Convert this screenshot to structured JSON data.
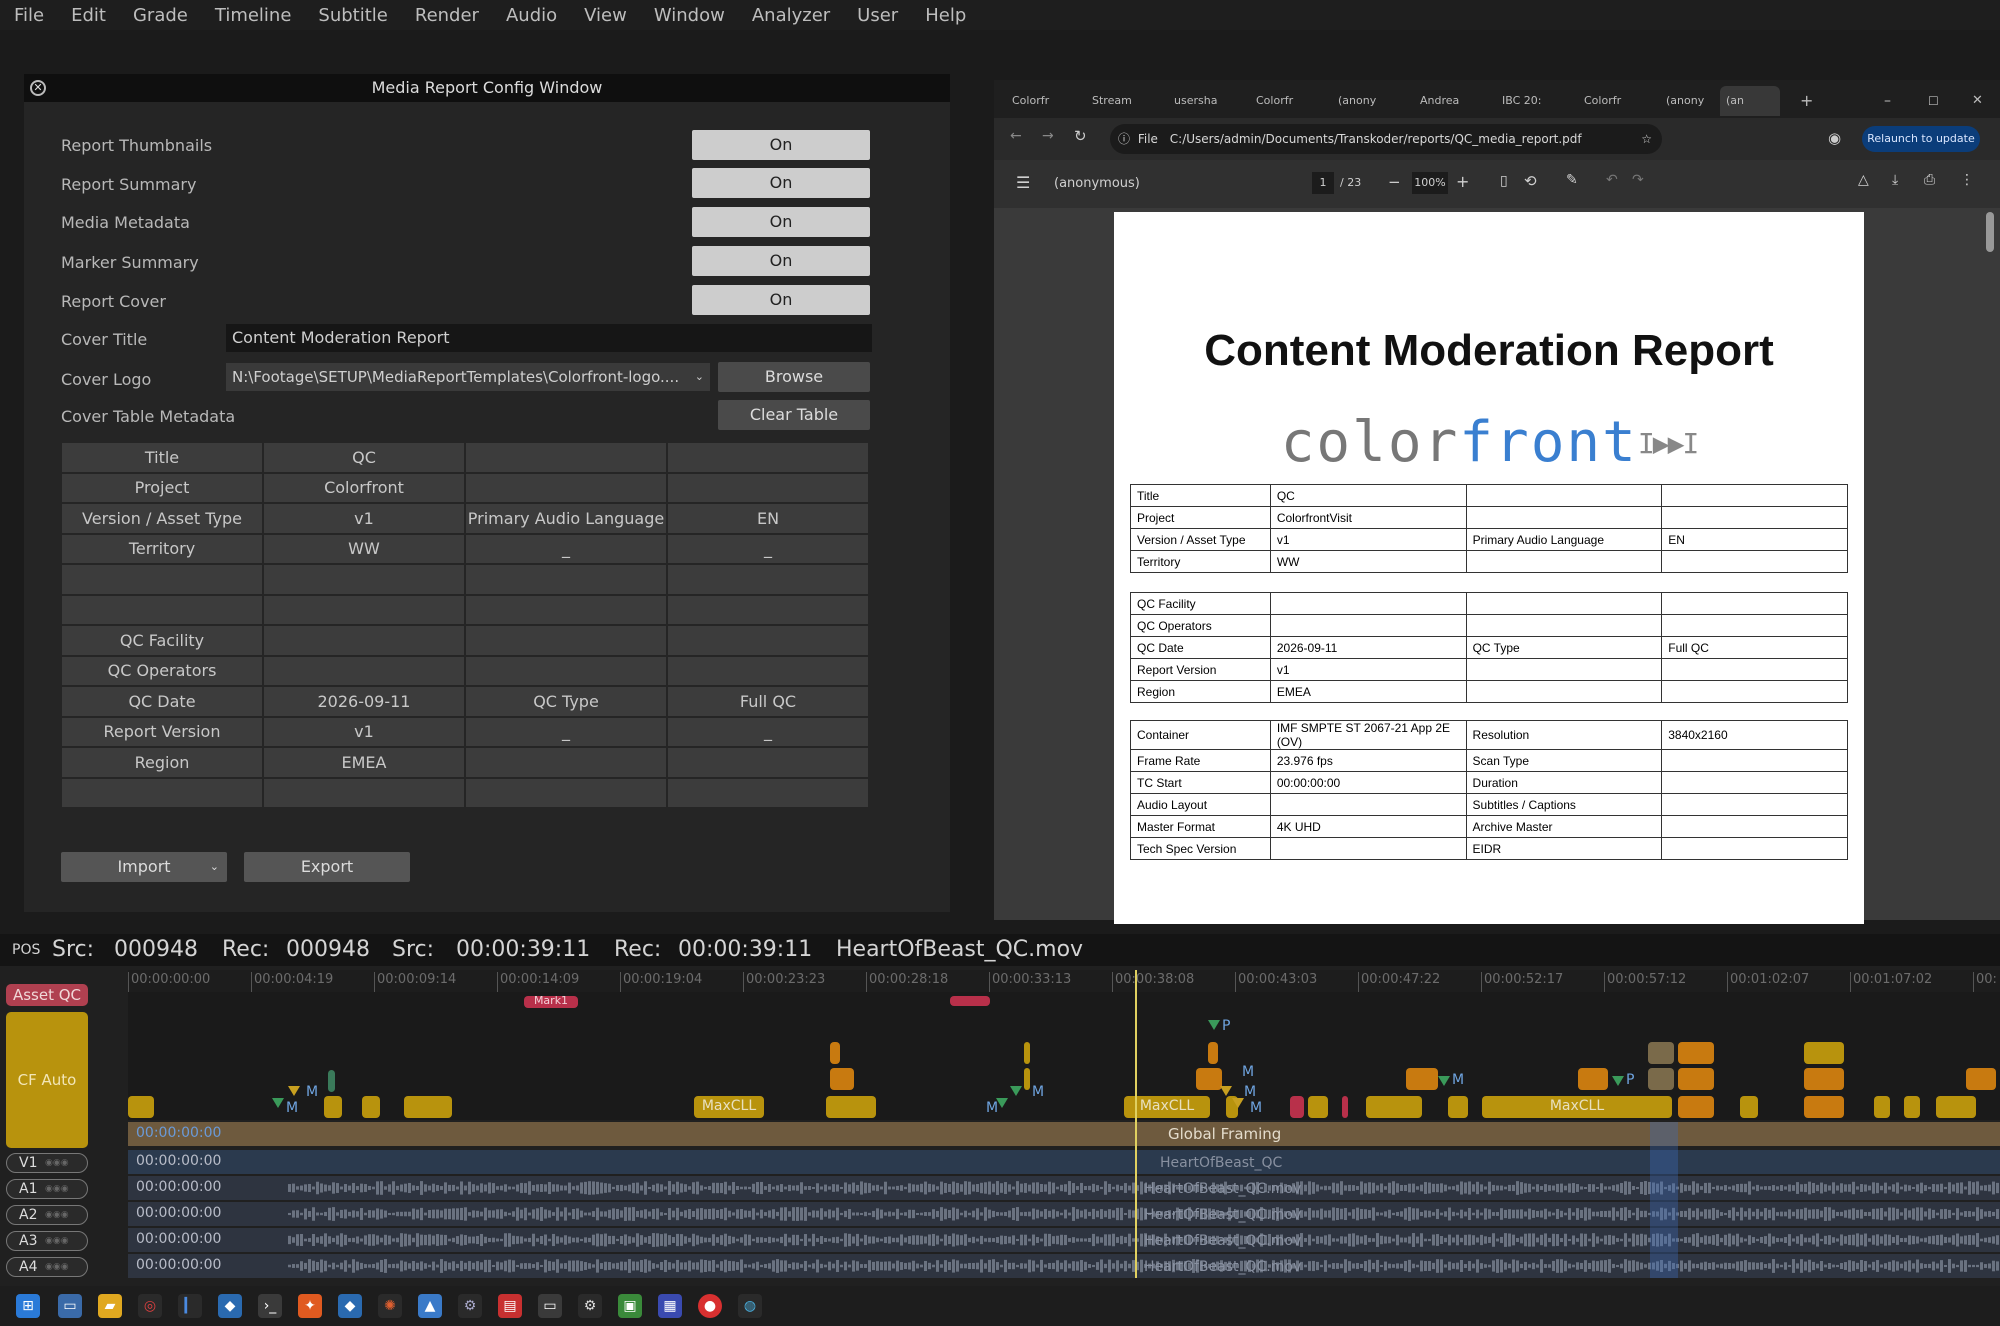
{
  "menu": [
    "File",
    "Edit",
    "Grade",
    "Timeline",
    "Subtitle",
    "Render",
    "Audio",
    "View",
    "Window",
    "Analyzer",
    "User",
    "Help"
  ],
  "config_window": {
    "title": "Media Report Config Window",
    "close_glyph": "✕",
    "toggles": [
      {
        "label": "Report Thumbnails",
        "value": "On"
      },
      {
        "label": "Report Summary",
        "value": "On"
      },
      {
        "label": "Media Metadata",
        "value": "On"
      },
      {
        "label": "Marker Summary",
        "value": "On"
      },
      {
        "label": "Report Cover",
        "value": "On"
      }
    ],
    "cover_title_label": "Cover Title",
    "cover_title_value": "Content Moderation Report",
    "cover_logo_label": "Cover Logo",
    "cover_logo_value": "N:\\Footage\\SETUP\\MediaReportTemplates\\Colorfront-logo....",
    "browse_label": "Browse",
    "cover_table_label": "Cover Table Metadata",
    "clear_table_label": "Clear Table",
    "table_rows": [
      [
        "Title",
        "QC",
        "",
        ""
      ],
      [
        "Project",
        "Colorfront",
        "",
        ""
      ],
      [
        "Version / Asset Type",
        "v1",
        "Primary Audio Language",
        "EN"
      ],
      [
        "Territory",
        "WW",
        "_",
        "_"
      ],
      [
        "",
        "",
        "",
        ""
      ],
      [
        "",
        "",
        "",
        ""
      ],
      [
        "QC Facility",
        "",
        "",
        ""
      ],
      [
        "QC Operators",
        "",
        "",
        ""
      ],
      [
        "QC Date",
        "2026-09-11",
        "QC Type",
        "Full QC"
      ],
      [
        "Report Version",
        "v1",
        "_",
        "_"
      ],
      [
        "Region",
        "EMEA",
        "",
        ""
      ],
      [
        "",
        "",
        "",
        ""
      ]
    ],
    "import_label": "Import",
    "export_label": "Export"
  },
  "browser": {
    "tabs": [
      "Colorfr",
      "Stream",
      "usersha",
      "Colorfr",
      "(anony",
      "Andrea",
      "IBC 20:",
      "Colorfr",
      "(anony",
      "(an"
    ],
    "new_tab": "+",
    "url_prefix": "File",
    "url": "C:/Users/admin/Documents/Transkoder/reports/QC_media_report.pdf",
    "relaunch": "Relaunch to update",
    "pdf_name": "(anonymous)",
    "page_current": "1",
    "page_total": "/ 23",
    "zoom": "100%"
  },
  "pdf": {
    "title": "Content Moderation Report",
    "logo_a": "color",
    "logo_b": "front",
    "table1": [
      [
        "Title",
        "QC",
        "",
        ""
      ],
      [
        "Project",
        "ColorfrontVisit",
        "",
        ""
      ],
      [
        "Version / Asset Type",
        "v1",
        "Primary Audio Language",
        "EN"
      ],
      [
        "Territory",
        "WW",
        "",
        ""
      ]
    ],
    "table2": [
      [
        "QC Facility",
        "",
        "",
        ""
      ],
      [
        "QC Operators",
        "",
        "",
        ""
      ],
      [
        "QC Date",
        "2026-09-11",
        "QC Type",
        "Full QC"
      ],
      [
        "Report Version",
        "v1",
        "",
        ""
      ],
      [
        "Region",
        "EMEA",
        "",
        ""
      ]
    ],
    "table3": [
      [
        "Container",
        "IMF SMPTE ST 2067-21 App 2E (OV)",
        "Resolution",
        "3840x2160"
      ],
      [
        "Frame Rate",
        "23.976 fps",
        "Scan Type",
        ""
      ],
      [
        "TC Start",
        "00:00:00:00",
        "Duration",
        ""
      ],
      [
        "Audio Layout",
        "",
        "Subtitles / Captions",
        ""
      ],
      [
        "Master Format",
        "4K UHD",
        "Archive Master",
        ""
      ],
      [
        "Tech Spec Version",
        "",
        "EIDR",
        ""
      ]
    ]
  },
  "timecode_bar": {
    "pos": "POS",
    "src_label": "Src:",
    "src_frame": "000948",
    "rec_label": "Rec:",
    "rec_frame": "000948",
    "src_tc_label": "Src:",
    "src_tc": "00:00:39:11",
    "rec_tc_label": "Rec:",
    "rec_tc": "00:00:39:11",
    "clip": "HeartOfBeast_QC.mov"
  },
  "timeline": {
    "ruler": [
      "00:00:00:00",
      "00:00:04:19",
      "00:00:09:14",
      "00:00:14:09",
      "00:00:19:04",
      "00:00:23:23",
      "00:00:28:18",
      "00:00:33:13",
      "00:00:38:08",
      "00:00:43:03",
      "00:00:47:22",
      "00:00:52:17",
      "00:00:57:12",
      "00:01:02:07",
      "00:01:07:02",
      "00:"
    ],
    "asset_qc": "Asset QC",
    "cf_auto_qc": "CF Auto QC",
    "mark_label": "Mark1",
    "maxcll": "MaxCLL",
    "m": "M",
    "p": "P",
    "global_tc": "00:00:00:00",
    "global_framing": "Global Framing",
    "tracks": [
      {
        "name": "V1",
        "tc": "00:00:00:00",
        "clip": "HeartOfBeast_QC"
      },
      {
        "name": "A1",
        "tc": "00:00:00:00",
        "clip": "HeartOfBeast_QC.mov"
      },
      {
        "name": "A2",
        "tc": "00:00:00:00",
        "clip": "HeartOfBeast_QC.mov"
      },
      {
        "name": "A3",
        "tc": "00:00:00:00",
        "clip": "HeartOfBeast_QC.mov"
      },
      {
        "name": "A4",
        "tc": "00:00:00:00",
        "clip": "HeartOfBeast_QC.mov"
      }
    ]
  },
  "colors": {
    "accent": "#b8930d",
    "playhead": "#e0d060",
    "relaunch": "#0b3d7a"
  }
}
